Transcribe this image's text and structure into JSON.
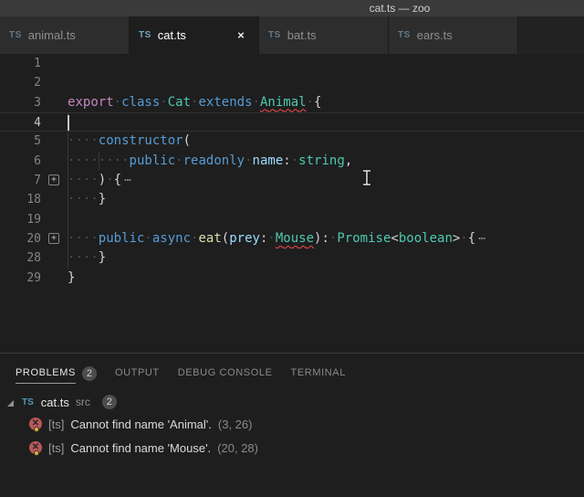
{
  "window": {
    "title": "cat.ts — zoo"
  },
  "tabs": [
    {
      "icon": "TS",
      "label": "animal.ts",
      "active": false
    },
    {
      "icon": "TS",
      "label": "cat.ts",
      "active": true,
      "close_label": "×"
    },
    {
      "icon": "TS",
      "label": "bat.ts",
      "active": false
    },
    {
      "icon": "TS",
      "label": "ears.ts",
      "active": false
    }
  ],
  "editor": {
    "cursor": "text-ibeam",
    "fold_glyph": "+",
    "lines": [
      {
        "num": "1",
        "tokens": [],
        "guides": []
      },
      {
        "num": "2",
        "tokens": [],
        "guides": []
      },
      {
        "num": "3",
        "guides": [],
        "tokens": [
          {
            "t": "export",
            "c": "ctrl"
          },
          {
            "t": " "
          },
          {
            "t": "class",
            "c": "kw"
          },
          {
            "t": " "
          },
          {
            "t": "Cat",
            "c": "type"
          },
          {
            "t": " "
          },
          {
            "t": "extends",
            "c": "kw"
          },
          {
            "t": " "
          },
          {
            "t": "Animal",
            "c": "type err"
          },
          {
            "t": " "
          },
          {
            "t": "{",
            "c": "plain"
          }
        ]
      },
      {
        "num": "4",
        "tokens": [],
        "guides": [
          0
        ],
        "current": true,
        "caret": true
      },
      {
        "num": "5",
        "guides": [
          0
        ],
        "tokens": [
          {
            "t": "    "
          },
          {
            "t": "constructor",
            "c": "kw"
          },
          {
            "t": "(",
            "c": "plain"
          }
        ]
      },
      {
        "num": "6",
        "guides": [
          0,
          4
        ],
        "tokens": [
          {
            "t": "        "
          },
          {
            "t": "public",
            "c": "kw"
          },
          {
            "t": " "
          },
          {
            "t": "readonly",
            "c": "kw"
          },
          {
            "t": " "
          },
          {
            "t": "name",
            "c": "var"
          },
          {
            "t": ":",
            "c": "plain"
          },
          {
            "t": " "
          },
          {
            "t": "string",
            "c": "type"
          },
          {
            "t": ",",
            "c": "plain"
          }
        ]
      },
      {
        "num": "7",
        "guides": [
          0
        ],
        "fold": true,
        "tokens": [
          {
            "t": "    "
          },
          {
            "t": ")",
            "c": "plain"
          },
          {
            "t": " "
          },
          {
            "t": "{",
            "c": "plain"
          },
          {
            "t": "⋯",
            "c": "fold-dots"
          }
        ]
      },
      {
        "num": "18",
        "guides": [
          0
        ],
        "tokens": [
          {
            "t": "    "
          },
          {
            "t": "}",
            "c": "plain"
          }
        ]
      },
      {
        "num": "19",
        "tokens": [],
        "guides": [
          0
        ]
      },
      {
        "num": "20",
        "guides": [
          0
        ],
        "fold": true,
        "tokens": [
          {
            "t": "    "
          },
          {
            "t": "public",
            "c": "kw"
          },
          {
            "t": " "
          },
          {
            "t": "async",
            "c": "kw"
          },
          {
            "t": " "
          },
          {
            "t": "eat",
            "c": "fn"
          },
          {
            "t": "(",
            "c": "plain"
          },
          {
            "t": "prey",
            "c": "var"
          },
          {
            "t": ":",
            "c": "plain"
          },
          {
            "t": " "
          },
          {
            "t": "Mouse",
            "c": "type err"
          },
          {
            "t": "):",
            "c": "plain"
          },
          {
            "t": " "
          },
          {
            "t": "Promise",
            "c": "type"
          },
          {
            "t": "<",
            "c": "plain"
          },
          {
            "t": "boolean",
            "c": "type"
          },
          {
            "t": ">",
            "c": "plain"
          },
          {
            "t": " "
          },
          {
            "t": "{",
            "c": "plain"
          },
          {
            "t": "⋯",
            "c": "fold-dots"
          }
        ]
      },
      {
        "num": "28",
        "guides": [
          0
        ],
        "tokens": [
          {
            "t": "    "
          },
          {
            "t": "}",
            "c": "plain"
          }
        ]
      },
      {
        "num": "29",
        "guides": [],
        "tokens": [
          {
            "t": "}",
            "c": "plain"
          }
        ]
      }
    ]
  },
  "panel": {
    "tabs": [
      {
        "label": "PROBLEMS",
        "badge": "2",
        "active": true
      },
      {
        "label": "OUTPUT",
        "active": false
      },
      {
        "label": "DEBUG CONSOLE",
        "active": false
      },
      {
        "label": "TERMINAL",
        "active": false
      }
    ],
    "tree": {
      "icon": "TS",
      "file": "cat.ts",
      "path": "src",
      "badge": "2"
    },
    "problems": [
      {
        "source": "[ts]",
        "message": "Cannot find name 'Animal'.",
        "location": "(3, 26)"
      },
      {
        "source": "[ts]",
        "message": "Cannot find name 'Mouse'.",
        "location": "(20, 28)"
      }
    ]
  },
  "colors": {
    "titlebar_bg": "#3a3a3a",
    "editor_bg": "#1e1e1e",
    "tab_inactive_bg": "#2d2d2d",
    "tab_active_bg": "#1e1e1e",
    "token_keyword": "#569cd6",
    "token_control": "#c586c0",
    "token_type": "#4ec9b0",
    "token_function": "#dcdcaa",
    "token_variable": "#9cdcfe",
    "token_plain": "#d4d4d4",
    "error_squiggle": "#f14c4c",
    "ts_icon_blue": "#519aba",
    "badge_bg": "#4d4d4d",
    "error_icon": "#b8575c"
  }
}
